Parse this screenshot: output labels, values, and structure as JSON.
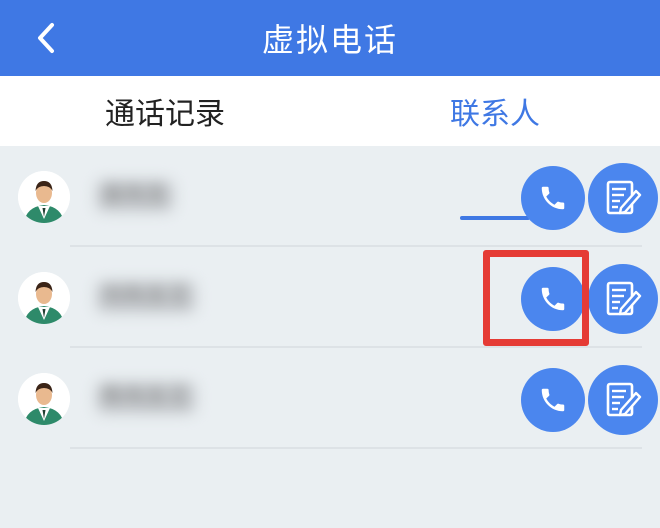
{
  "header": {
    "title": "虚拟电话",
    "back_icon": "chevron-left-icon"
  },
  "tabs": [
    {
      "label": "通话记录",
      "active": false
    },
    {
      "label": "联系人",
      "active": true
    }
  ],
  "colors": {
    "primary": "#3f78e4",
    "button": "#4b86ee",
    "background": "#eaeff2",
    "highlight": "#e53b35"
  },
  "contacts": [
    {
      "name": "吴先生"
    },
    {
      "name": "刘先生王"
    },
    {
      "name": "陈先生王"
    }
  ],
  "icons": {
    "avatar": "person-avatar-icon",
    "call": "phone-icon",
    "edit": "edit-note-icon"
  }
}
